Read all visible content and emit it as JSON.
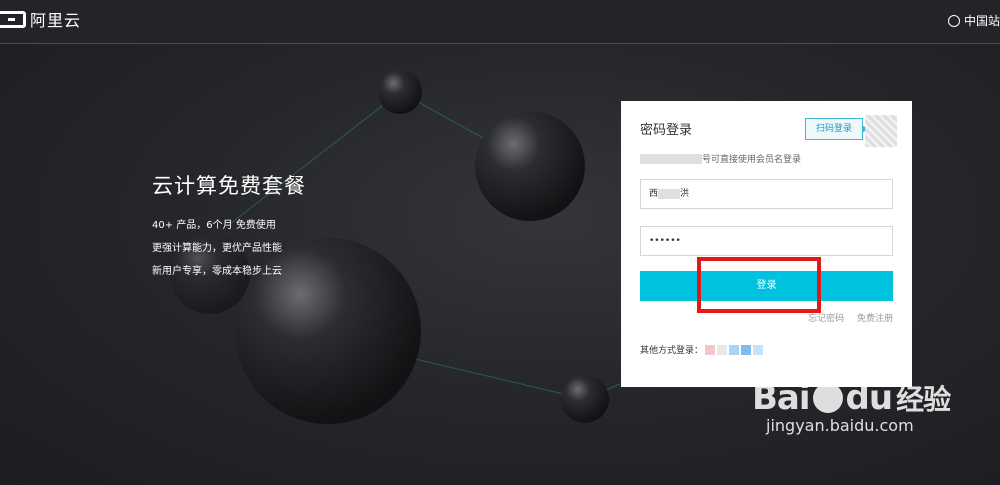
{
  "header": {
    "logo_text": "阿里云",
    "region_label": "中国站"
  },
  "promo": {
    "title": "云计算免费套餐",
    "lines": [
      "40+ 产品，6个月 免费使用",
      "更强计算能力，更优产品性能",
      "新用户专享，零成本稳步上云"
    ]
  },
  "login": {
    "title": "密码登录",
    "qr_tag": "扫码登录",
    "hint_text": "号可直接使用会员名登录",
    "username_prefix": "西",
    "username_suffix": "洪",
    "password_mask": "••••••",
    "submit_label": "登录",
    "forgot_label": "忘记密码",
    "register_label": "免费注册",
    "other_label": "其他方式登录："
  },
  "watermark": {
    "brand": "Bai",
    "brand2": "du",
    "product": "经验",
    "url": "jingyan.baidu.com"
  },
  "colors": {
    "accent": "#00c1de",
    "highlight": "#e0191b"
  }
}
